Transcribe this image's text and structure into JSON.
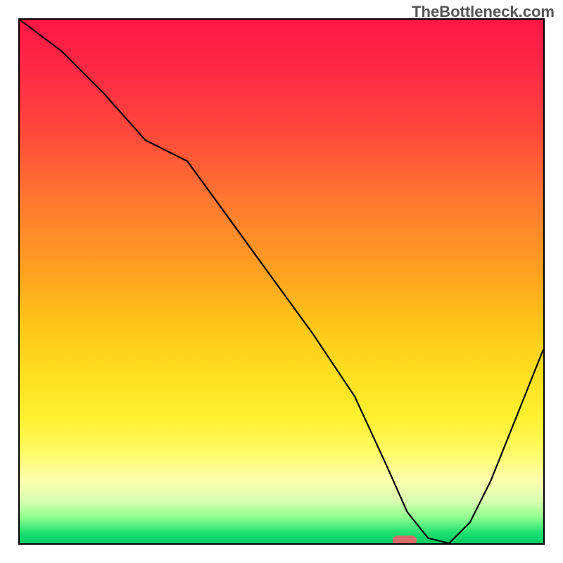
{
  "watermark": "TheBottleneck.com",
  "chart_data": {
    "type": "line",
    "title": "",
    "xlabel": "",
    "ylabel": "",
    "x": [
      0.0,
      0.08,
      0.16,
      0.24,
      0.32,
      0.4,
      0.48,
      0.56,
      0.64,
      0.7,
      0.74,
      0.78,
      0.82,
      0.86,
      0.9,
      0.94,
      1.0
    ],
    "values": [
      1.0,
      0.94,
      0.86,
      0.77,
      0.73,
      0.62,
      0.51,
      0.4,
      0.28,
      0.15,
      0.06,
      0.01,
      0.0,
      0.04,
      0.12,
      0.22,
      0.37
    ],
    "xlim": [
      0,
      1
    ],
    "ylim": [
      0,
      1
    ],
    "marker": {
      "x": 0.735,
      "y": 0.0
    }
  }
}
